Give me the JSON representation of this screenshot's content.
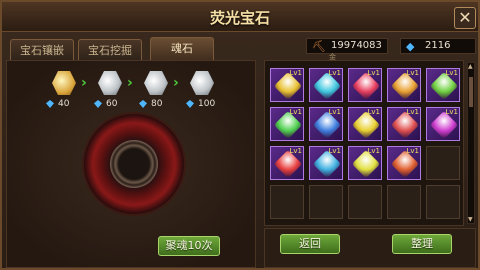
{
  "window": {
    "title": "荧光宝石",
    "close_label": "✕"
  },
  "tabs": [
    {
      "label": "宝石镶嵌",
      "active": false
    },
    {
      "label": "宝石挖掘",
      "active": false
    },
    {
      "label": "魂石",
      "active": true
    }
  ],
  "resources": {
    "gold": {
      "value": "19974083",
      "sub_label": "金",
      "icon": "shovel-icon"
    },
    "diamond": {
      "value": "2116",
      "icon": "diamond-icon"
    }
  },
  "upgrade_chain": {
    "stones": [
      {
        "icon": "gold-soulstone-icon",
        "cost": "40"
      },
      {
        "icon": "silver-soulstone-icon",
        "cost": "60"
      },
      {
        "icon": "silver-soulstone-icon",
        "cost": "80"
      },
      {
        "icon": "silver-soulstone-icon",
        "cost": "100"
      }
    ]
  },
  "buttons": {
    "soul_10": "聚魂10次",
    "back": "返回",
    "sort": "整理"
  },
  "inventory": {
    "level_label": "Lv1",
    "slots": [
      {
        "filled": true,
        "color": "#e8c030"
      },
      {
        "filled": true,
        "color": "#40c8e0"
      },
      {
        "filled": true,
        "color": "#e84060"
      },
      {
        "filled": true,
        "color": "#e8a030"
      },
      {
        "filled": true,
        "color": "#70d040"
      },
      {
        "filled": true,
        "color": "#50d050"
      },
      {
        "filled": true,
        "color": "#4080e0"
      },
      {
        "filled": true,
        "color": "#e8d030"
      },
      {
        "filled": true,
        "color": "#e05050"
      },
      {
        "filled": true,
        "color": "#d040d0"
      },
      {
        "filled": true,
        "color": "#e84040"
      },
      {
        "filled": true,
        "color": "#40b0e0"
      },
      {
        "filled": true,
        "color": "#e0e040"
      },
      {
        "filled": true,
        "color": "#e06030"
      },
      {
        "filled": false
      },
      {
        "filled": false
      },
      {
        "filled": false
      },
      {
        "filled": false
      },
      {
        "filled": false
      },
      {
        "filled": false
      }
    ]
  }
}
